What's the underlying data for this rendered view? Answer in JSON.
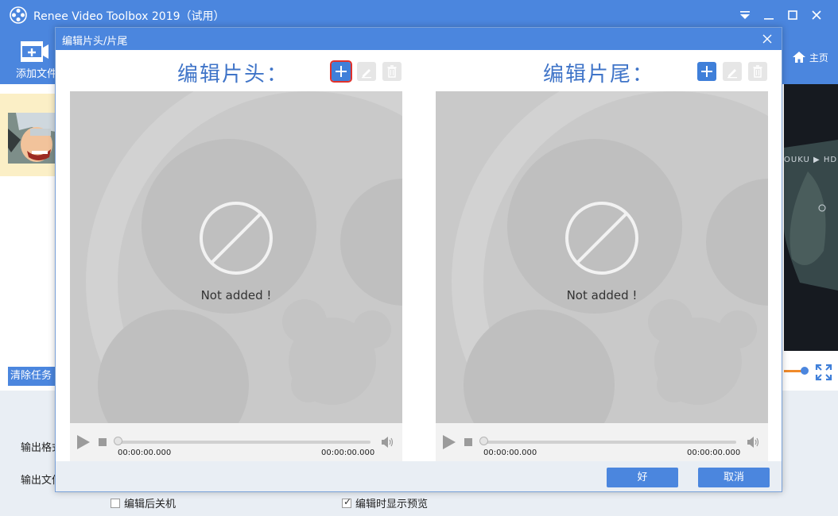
{
  "app": {
    "title": "Renee Video Toolbox 2019（试用）",
    "toolbar": {
      "add_file_label": "添加文件",
      "home_label": "主页"
    },
    "preview": {
      "watermark": "OUKU ▶ HD"
    },
    "clear_task_label": "清除任务",
    "output_format_label": "输出格式",
    "output_folder_label": "输出文件夹",
    "shutdown_after_edit_label": "编辑后关机",
    "shutdown_after_edit_checked": false,
    "show_preview_label": "编辑时显示预览",
    "show_preview_checked": true
  },
  "dialog": {
    "title": "编辑片头/片尾",
    "panes": [
      {
        "title": "编辑片头：",
        "placeholder": "Not added !",
        "time_start": "00:00:00.000",
        "time_end": "00:00:00.000"
      },
      {
        "title": "编辑片尾：",
        "placeholder": "Not added !",
        "time_start": "00:00:00.000",
        "time_end": "00:00:00.000"
      }
    ],
    "ok_label": "好",
    "cancel_label": "取消"
  },
  "colors": {
    "brand_blue": "#4b86de",
    "title_blue": "#3f74c8",
    "highlight_red": "#e0322c",
    "video_placeholder": "#c9c9c9"
  }
}
